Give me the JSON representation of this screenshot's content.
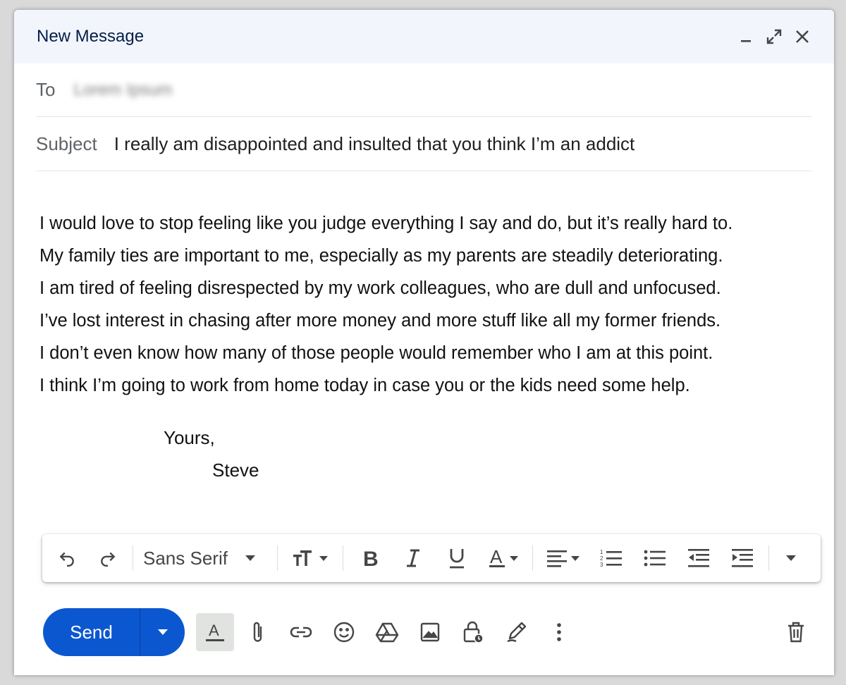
{
  "window": {
    "title": "New Message",
    "controls": [
      "minimize-icon",
      "expand-icon",
      "close-icon"
    ]
  },
  "to": {
    "label": "To",
    "value": "Lorem Ipsum"
  },
  "subject": {
    "label": "Subject",
    "value": "I really am disappointed and insulted that you think I’m an addict"
  },
  "body": {
    "lines": [
      "I would love to stop feeling like you judge everything I say and do, but it’s really hard to.",
      "My family ties are important to me, especially as my parents are steadily deteriorating.",
      "I am tired of feeling disrespected by my work colleagues, who are dull and unfocused.",
      "I’ve lost interest in chasing after more money and more stuff like all my former friends.",
      "I don’t even know how many of those people would remember who I am at this point.",
      "I think I’m going to work from home today in case you or the kids need some help."
    ],
    "signoff": "Yours,",
    "signature": "Steve"
  },
  "toolbar": {
    "font": "Sans Serif",
    "icons": [
      "undo-icon",
      "redo-icon",
      "font-size-icon",
      "bold-icon",
      "italic-icon",
      "underline-icon",
      "text-color-icon",
      "align-icon",
      "numbered-list-icon",
      "bulleted-list-icon",
      "indent-less-icon",
      "indent-more-icon",
      "more-formatting-icon"
    ]
  },
  "bottom": {
    "send_label": "Send",
    "icons": [
      "formatting-options-icon",
      "attach-icon",
      "link-icon",
      "emoji-icon",
      "drive-icon",
      "photo-icon",
      "confidential-icon",
      "signature-icon",
      "more-options-icon",
      "trash-icon"
    ],
    "accent": "#0b57d0"
  },
  "colors": {
    "header_bg": "#f2f6fc",
    "title": "#041e49"
  }
}
